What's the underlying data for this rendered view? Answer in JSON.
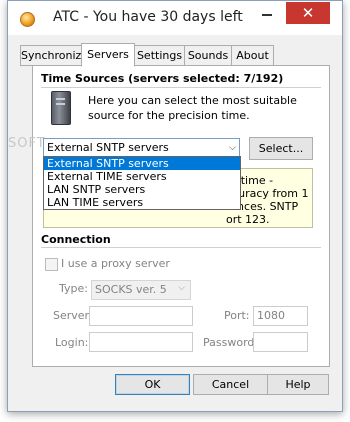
{
  "window": {
    "title": "ATC - You have 30 days left",
    "minimize_glyph": "–",
    "close_glyph": "✕"
  },
  "tabs": [
    {
      "label": "Synchronize",
      "active": false
    },
    {
      "label": "Servers",
      "active": true
    },
    {
      "label": "Settings",
      "active": false
    },
    {
      "label": "Sounds",
      "active": false
    },
    {
      "label": "About",
      "active": false
    }
  ],
  "time_sources": {
    "heading": "Time Sources (servers selected: 7/192)",
    "description": "Here you can select the most suitable source for the precision time.",
    "selected_source": "External SNTP servers",
    "select_button": "Select...",
    "dropdown_options": [
      "External SNTP servers",
      "External TIME servers",
      "LAN SNTP servers",
      "LAN TIME servers"
    ],
    "info_text": "or time - ccuracy from 1 tances. SNTP ort 123."
  },
  "connection": {
    "heading": "Connection",
    "proxy_label": "I use a proxy server",
    "type_label": "Type:",
    "type_value": "SOCKS ver. 5",
    "server_label": "Server:",
    "server_value": "",
    "port_label": "Port:",
    "port_value": "1080",
    "login_label": "Login:",
    "login_value": "",
    "password_label": "Password:",
    "password_value": ""
  },
  "buttons": {
    "ok": "OK",
    "cancel": "Cancel",
    "help": "Help"
  },
  "watermark": "SOFT",
  "colors": {
    "close_button": "#c7372f",
    "selection": "#0078d7",
    "info_bg": "#ffffe1"
  }
}
